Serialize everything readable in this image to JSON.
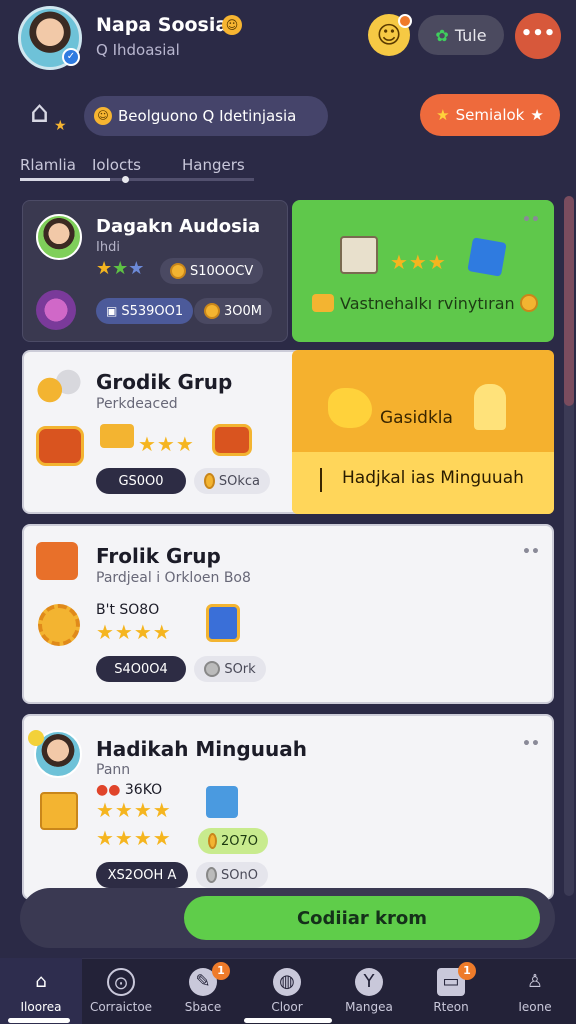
{
  "header": {
    "title": "Napa Soosial",
    "title_emoji": "☺",
    "subtitle": "Q  Ihdoasial",
    "tule_label": "Tule",
    "more_label": "•••"
  },
  "search": {
    "text": "Beolguono Q  Idetinjasia",
    "emoji": "☺"
  },
  "semialok_label": "Semialok",
  "tabs": [
    "Rlamlia",
    "Iolocts",
    "Hangers"
  ],
  "cards": {
    "featured": {
      "title": "Dagakn Audosia",
      "sub": "Ihdi",
      "value_pill": "S10OOCV",
      "pill_a": "S539OO1",
      "pill_b": "3O0M"
    },
    "green": {
      "caption": "Vastnehalkı rvinytıran"
    },
    "group1": {
      "title": "Grodik Grup",
      "sub": "Perkdeaced",
      "pill_a": "GS0O0",
      "pill_b": "SOkca"
    },
    "orange": {
      "label": "Gasidkla",
      "caption": "Hadjkal ias Minguuah"
    },
    "group2": {
      "title": "Frolik Grup",
      "sub": "Pardjeal i Orkloen Bo8",
      "price": "B't SO8O",
      "pill_a": "S4O0O4",
      "pill_b": "SOrk"
    },
    "group3": {
      "title": "Hadikah Minguuah",
      "sub": "Pann",
      "price": "36KO",
      "badge": "2O7O",
      "pill_a": "XS2OOH A",
      "pill_b": "SOnO"
    }
  },
  "cta_label": "Codiiar krom",
  "nav": [
    {
      "label": "Iloorea",
      "icon": "home-icon"
    },
    {
      "label": "Corraictoe",
      "icon": "compass-icon"
    },
    {
      "label": "Sbace",
      "icon": "space-icon",
      "badge": "1"
    },
    {
      "label": "Cloor",
      "icon": "globe-icon"
    },
    {
      "label": "Mangea",
      "icon": "manage-icon"
    },
    {
      "label": "Rteon",
      "icon": "box-icon",
      "badge": "1"
    },
    {
      "label": "Ieone",
      "icon": "profile-icon"
    }
  ],
  "colors": {
    "background": "#2b2a46",
    "accent_green": "#5fcd4a",
    "accent_orange": "#ee6a3c",
    "accent_yellow": "#f5b12e"
  }
}
